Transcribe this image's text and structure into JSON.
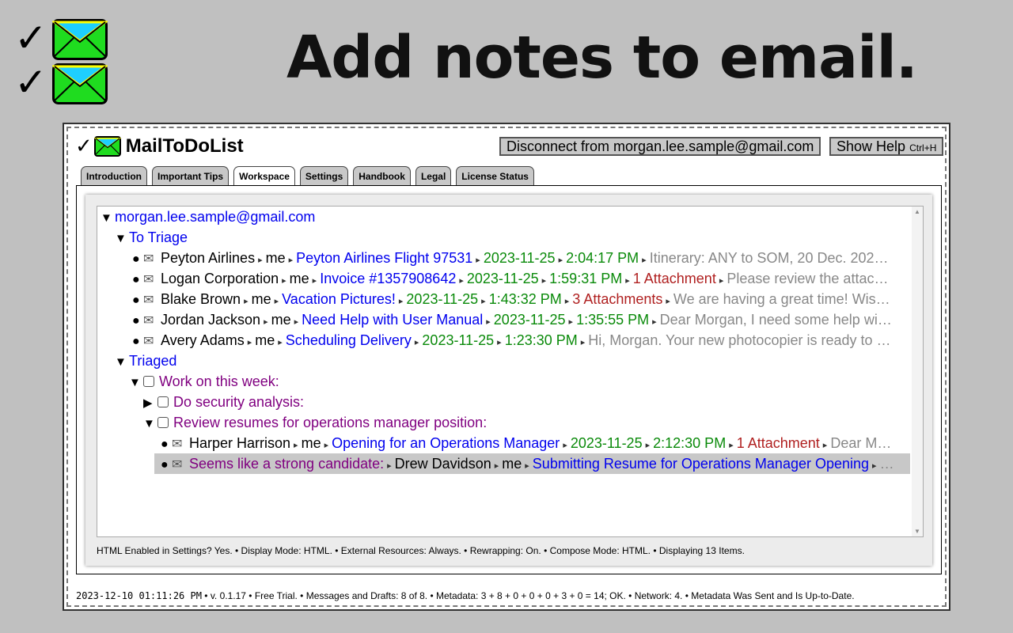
{
  "headline": "Add notes to email.",
  "app": {
    "name": "MailToDoList",
    "disconnect_label": "Disconnect from morgan.lee.sample@gmail.com",
    "help_label": "Show Help",
    "help_shortcut": "Ctrl+H"
  },
  "tabs": [
    "Introduction",
    "Important Tips",
    "Workspace",
    "Settings",
    "Handbook",
    "Legal",
    "License Status"
  ],
  "active_tab": "Workspace",
  "tree": {
    "account": "morgan.lee.sample@gmail.com",
    "to_triage_label": "To Triage",
    "to_triage": [
      {
        "from": "Peyton Airlines",
        "to": "me",
        "subject": "Peyton Airlines Flight 97531",
        "date": "2023-11-25",
        "time": "2:04:17 PM",
        "attachments": "",
        "preview": "Itinerary: ANY to SOM, 20 Dec. 202…"
      },
      {
        "from": "Logan Corporation",
        "to": "me",
        "subject": "Invoice #1357908642",
        "date": "2023-11-25",
        "time": "1:59:31 PM",
        "attachments": "1 Attachment",
        "preview": "Please review the attac…"
      },
      {
        "from": "Blake Brown",
        "to": "me",
        "subject": "Vacation Pictures!",
        "date": "2023-11-25",
        "time": "1:43:32 PM",
        "attachments": "3 Attachments",
        "preview": "We are having a great time! Wis…"
      },
      {
        "from": "Jordan Jackson",
        "to": "me",
        "subject": "Need Help with User Manual",
        "date": "2023-11-25",
        "time": "1:35:55 PM",
        "attachments": "",
        "preview": "Dear Morgan, I need some help wi…"
      },
      {
        "from": "Avery Adams",
        "to": "me",
        "subject": "Scheduling Delivery",
        "date": "2023-11-25",
        "time": "1:23:30 PM",
        "attachments": "",
        "preview": "Hi, Morgan. Your new photocopier is ready to …"
      }
    ],
    "triaged_label": "Triaged",
    "task_week": "Work on this week:",
    "task_security": "Do security analysis:",
    "task_resumes": "Review resumes for operations manager position:",
    "resume_mail_1": {
      "from": "Harper Harrison",
      "to": "me",
      "subject": "Opening for an Operations Manager",
      "date": "2023-11-25",
      "time": "2:12:30 PM",
      "attachments": "1 Attachment",
      "preview": "Dear M…"
    },
    "resume_mail_2": {
      "note": "Seems like a strong candidate:",
      "from": "Drew Davidson",
      "to": "me",
      "subject": "Submitting Resume for Operations Manager Opening",
      "preview": "…"
    }
  },
  "status_bar": "HTML Enabled in Settings? Yes.  •  Display Mode: HTML.  •  External Resources: Always.  •  Rewrapping: On.  •  Compose Mode: HTML.  •  Displaying 13 Items.",
  "footer": {
    "timestamp": "2023-12-10 01:11:26 PM",
    "rest": " •  v. 0.1.17  •  Free Trial.  •  Messages and Drafts: 8 of 8.  •  Metadata: 3 + 8 + 0 + 0 + 0 + 3 + 0 = 14; OK.  •  Network: 4.  •  Metadata Was Sent and Is Up-to-Date."
  },
  "colors": {
    "envelope_fill": "#1fdc1f",
    "envelope_flap": "#1ecfff",
    "envelope_flap_edge": "#ffff00",
    "link": "#0000ee",
    "date": "#0a8a0a",
    "attachment": "#b02020",
    "note": "#800080",
    "selected_row": "#c8c8c8"
  }
}
